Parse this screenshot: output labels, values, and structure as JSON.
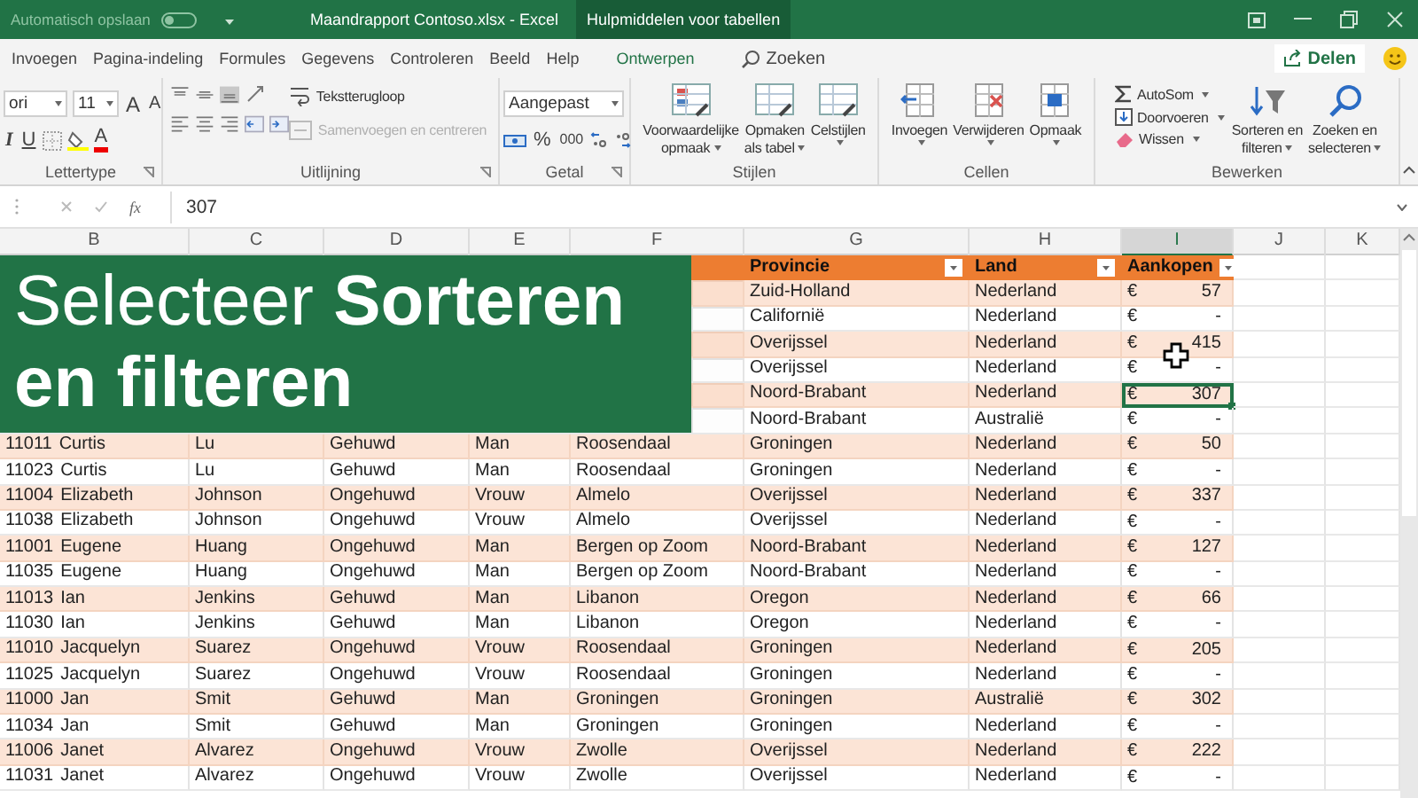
{
  "title_bar": {
    "autosave": {
      "label": "Automatisch opslaan",
      "on": false
    },
    "title": "Maandrapport Contoso.xlsx  -  Excel",
    "context": "Hulpmiddelen voor tabellen"
  },
  "tabs": [
    {
      "label": "Invoegen",
      "selected": false,
      "kind": "normal"
    },
    {
      "label": "Pagina-indeling",
      "selected": false,
      "kind": "normal"
    },
    {
      "label": "Formules",
      "selected": false,
      "kind": "normal"
    },
    {
      "label": "Gegevens",
      "selected": false,
      "kind": "normal"
    },
    {
      "label": "Controleren",
      "selected": false,
      "kind": "normal"
    },
    {
      "label": "Beeld",
      "selected": false,
      "kind": "normal"
    },
    {
      "label": "Help",
      "selected": false,
      "kind": "normal"
    },
    {
      "label": "Ontwerpen",
      "selected": false,
      "kind": "contextual"
    }
  ],
  "search": {
    "placeholder": "Zoeken"
  },
  "share": {
    "label": "Delen"
  },
  "ribbon": {
    "font": {
      "name": "ori",
      "size": "11",
      "grow": "A",
      "shrink": "A",
      "italic": "I",
      "underline": "U",
      "color_letter": "A",
      "group_label": "Lettertype"
    },
    "alignment": {
      "wrap": "Tekstterugloop",
      "merge": {
        "label": "Samenvoegen en centreren",
        "disabled": true
      },
      "group_label": "Uitlijning"
    },
    "number": {
      "format": "Aangepast",
      "percent": "%",
      "thousands": "000",
      "group_label": "Getal"
    },
    "styles": {
      "buttons": [
        {
          "lines": [
            "Voorwaardelijke",
            "opmaak"
          ]
        },
        {
          "lines": [
            "Opmaken",
            "als tabel"
          ]
        },
        {
          "lines": [
            "Celstijlen"
          ]
        }
      ],
      "group_label": "Stijlen"
    },
    "cells": {
      "buttons": [
        {
          "lines": [
            "Invoegen"
          ]
        },
        {
          "lines": [
            "Verwijderen"
          ]
        },
        {
          "lines": [
            "Opmaak"
          ]
        }
      ],
      "group_label": "Cellen"
    },
    "editing": {
      "small": [
        {
          "label": "AutoSom",
          "kind": "sum"
        },
        {
          "label": "Doorvoeren",
          "kind": "fill"
        },
        {
          "label": "Wissen",
          "kind": "clear"
        }
      ],
      "large": [
        {
          "lines": [
            "Sorteren en",
            "filteren"
          ],
          "kind": "sort"
        },
        {
          "lines": [
            "Zoeken en",
            "selecteren"
          ],
          "kind": "find"
        }
      ],
      "group_label": "Bewerken"
    }
  },
  "formula_bar": {
    "function_label": "fx",
    "value": "307"
  },
  "banner": {
    "text": "Selecteer **Sorteren en filteren**"
  },
  "table": {
    "columns": [
      {
        "letter": "B",
        "selected": false
      },
      {
        "letter": "C",
        "selected": false
      },
      {
        "letter": "D",
        "selected": false
      },
      {
        "letter": "E",
        "selected": false
      },
      {
        "letter": "F",
        "selected": false
      },
      {
        "letter": "G",
        "selected": false
      },
      {
        "letter": "H",
        "selected": false
      },
      {
        "letter": "I",
        "selected": true
      },
      {
        "letter": "J",
        "selected": false
      },
      {
        "letter": "K",
        "selected": false
      }
    ],
    "headers": {
      "province": "Provincie",
      "country": "Land",
      "amount": "Aankopen"
    },
    "rows": [
      {
        "province": "Zuid-Holland",
        "country": "Nederland",
        "currency": "€",
        "amount": "57",
        "selected": false
      },
      {
        "province": "Californië",
        "country": "Nederland",
        "currency": "€",
        "amount": "-",
        "selected": false
      },
      {
        "province": "Overijssel",
        "country": "Nederland",
        "currency": "€",
        "amount": "415",
        "selected": false
      },
      {
        "province": "Overijssel",
        "country": "Nederland",
        "currency": "€",
        "amount": "-",
        "selected": false
      },
      {
        "province": "Noord-Brabant",
        "country": "Nederland",
        "currency": "€",
        "amount": "307",
        "selected": true
      },
      {
        "province": "Noord-Brabant",
        "country": "Australië",
        "currency": "€",
        "amount": "-",
        "selected": false
      },
      {
        "id": "11011",
        "first_name": "Curtis",
        "last_name": "Lu",
        "status": "Gehuwd",
        "gender": "Man",
        "city": "Roosendaal",
        "province": "Groningen",
        "country": "Nederland",
        "currency": "€",
        "amount": "50",
        "selected": false
      },
      {
        "id": "11023",
        "first_name": "Curtis",
        "last_name": "Lu",
        "status": "Gehuwd",
        "gender": "Man",
        "city": "Roosendaal",
        "province": "Groningen",
        "country": "Nederland",
        "currency": "€",
        "amount": "-",
        "selected": false
      },
      {
        "id": "11004",
        "first_name": "Elizabeth",
        "last_name": "Johnson",
        "status": "Ongehuwd",
        "gender": "Vrouw",
        "city": "Almelo",
        "province": "Overijssel",
        "country": "Nederland",
        "currency": "€",
        "amount": "337",
        "selected": false
      },
      {
        "id": "11038",
        "first_name": "Elizabeth",
        "last_name": "Johnson",
        "status": "Ongehuwd",
        "gender": "Vrouw",
        "city": "Almelo",
        "province": "Overijssel",
        "country": "Nederland",
        "currency": "€",
        "amount": "-",
        "selected": false
      },
      {
        "id": "11001",
        "first_name": "Eugene",
        "last_name": "Huang",
        "status": "Ongehuwd",
        "gender": "Man",
        "city": "Bergen op Zoom",
        "province": "Noord-Brabant",
        "country": "Nederland",
        "currency": "€",
        "amount": "127",
        "selected": false
      },
      {
        "id": "11035",
        "first_name": "Eugene",
        "last_name": "Huang",
        "status": "Ongehuwd",
        "gender": "Man",
        "city": "Bergen op Zoom",
        "province": "Noord-Brabant",
        "country": "Nederland",
        "currency": "€",
        "amount": "-",
        "selected": false
      },
      {
        "id": "11013",
        "first_name": "Ian",
        "last_name": "Jenkins",
        "status": "Gehuwd",
        "gender": "Man",
        "city": "Libanon",
        "province": "Oregon",
        "country": "Nederland",
        "currency": "€",
        "amount": "66",
        "selected": false
      },
      {
        "id": "11030",
        "first_name": "Ian",
        "last_name": "Jenkins",
        "status": "Gehuwd",
        "gender": "Man",
        "city": "Libanon",
        "province": "Oregon",
        "country": "Nederland",
        "currency": "€",
        "amount": "-",
        "selected": false
      },
      {
        "id": "11010",
        "first_name": "Jacquelyn",
        "last_name": "Suarez",
        "status": "Ongehuwd",
        "gender": "Vrouw",
        "city": "Roosendaal",
        "province": "Groningen",
        "country": "Nederland",
        "currency": "€",
        "amount": "205",
        "selected": false
      },
      {
        "id": "11025",
        "first_name": "Jacquelyn",
        "last_name": "Suarez",
        "status": "Ongehuwd",
        "gender": "Vrouw",
        "city": "Roosendaal",
        "province": "Groningen",
        "country": "Nederland",
        "currency": "€",
        "amount": "-",
        "selected": false
      },
      {
        "id": "11000",
        "first_name": "Jan",
        "last_name": "Smit",
        "status": "Gehuwd",
        "gender": "Man",
        "city": "Groningen",
        "province": "Groningen",
        "country": "Australië",
        "currency": "€",
        "amount": "302",
        "selected": false
      },
      {
        "id": "11034",
        "first_name": "Jan",
        "last_name": "Smit",
        "status": "Gehuwd",
        "gender": "Man",
        "city": "Groningen",
        "province": "Groningen",
        "country": "Nederland",
        "currency": "€",
        "amount": "-",
        "selected": false
      },
      {
        "id": "11006",
        "first_name": "Janet",
        "last_name": "Alvarez",
        "status": "Ongehuwd",
        "gender": "Vrouw",
        "city": "Zwolle",
        "province": "Overijssel",
        "country": "Nederland",
        "currency": "€",
        "amount": "222",
        "selected": false
      },
      {
        "id": "11031",
        "first_name": "Janet",
        "last_name": "Alvarez",
        "status": "Ongehuwd",
        "gender": "Vrouw",
        "city": "Zwolle",
        "province": "Overijssel",
        "country": "Nederland",
        "currency": "€",
        "amount": "-",
        "selected": false
      }
    ]
  }
}
